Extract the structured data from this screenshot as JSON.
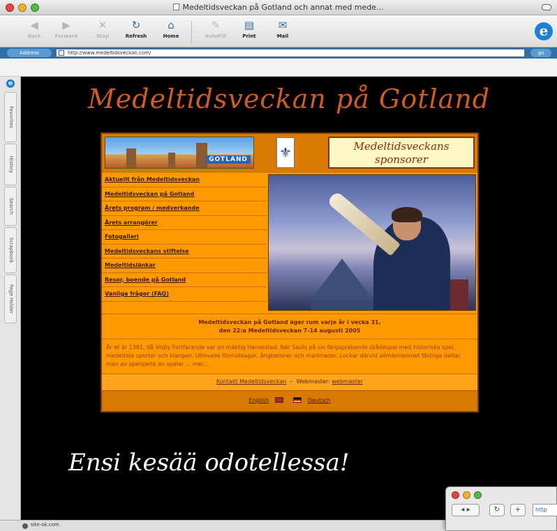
{
  "window": {
    "title": "Medeltidsveckan på Gotland och annat med mede...",
    "colors": {
      "close": "#e2463f",
      "minimize": "#f0b429",
      "zoom": "#55b94a"
    }
  },
  "toolbar": {
    "buttons": [
      {
        "label": "Back",
        "icon": "left-arrow-icon",
        "enabled": false
      },
      {
        "label": "Forward",
        "icon": "right-arrow-icon",
        "enabled": false
      },
      {
        "label": "Stop",
        "icon": "stop-x-icon",
        "enabled": false
      },
      {
        "label": "Refresh",
        "icon": "refresh-icon",
        "enabled": true
      },
      {
        "label": "Home",
        "icon": "home-icon",
        "enabled": true
      },
      {
        "label": "AutoFill",
        "icon": "autofill-icon",
        "enabled": false
      },
      {
        "label": "Print",
        "icon": "print-icon",
        "enabled": true
      },
      {
        "label": "Mail",
        "icon": "mail-icon",
        "enabled": true
      }
    ],
    "logo": "e"
  },
  "address_bar": {
    "label": "Address",
    "url": "http://www.medeltidsveckan.com/",
    "go_label": "go"
  },
  "explorer_tabs": [
    "Favorites",
    "History",
    "Search",
    "Scrapbook",
    "Page Holder"
  ],
  "site": {
    "title": "Medeltidsveckan på Gotland",
    "banner_text": "GOTLAND",
    "sponsor_line1": "Medeltidsveckans",
    "sponsor_line2": "sponsorer",
    "nav": [
      "Aktuellt från Medeltidsveckan",
      "Medeltidsveckan på Gotland",
      "Årets program / medverkande",
      "Årets arrangörer",
      "Fotogalleri",
      "Medeltidsveckans stiftelse",
      "Medeltidslänkar",
      "Resor, boende på Gotland",
      "Vanliga frågor (FAQ)"
    ],
    "info_line1": "Medeltidsveckan på Gotland äger rum varje år i vecka 31,",
    "info_line2": "den 22:a Medeltidsveckan 7-14 augusti 2005",
    "body_text": "År et är 1361, då Visby Fortfarande var en mäktig Hansestad. När Sauls på sin färgsprakande skådespel med historiska spel, medeltida sporter och klangen. Utlovade förmiddagar, ångbetoner och marknader. Lockar därvid allmännamnet fästliga deltar man av spelsjarte än spalar ... mer...",
    "contact_link": "Kontakt Medeltidsveckan",
    "webmaster_label": "Webmaster:",
    "webmaster_link": "webmaster",
    "lang_english": "English",
    "lang_deutsch": "Deutsch"
  },
  "caption": "Ensi kesää odotellessa!",
  "status": {
    "text": "site-ok.com"
  },
  "mini_window": {
    "address_snippet": "http"
  }
}
